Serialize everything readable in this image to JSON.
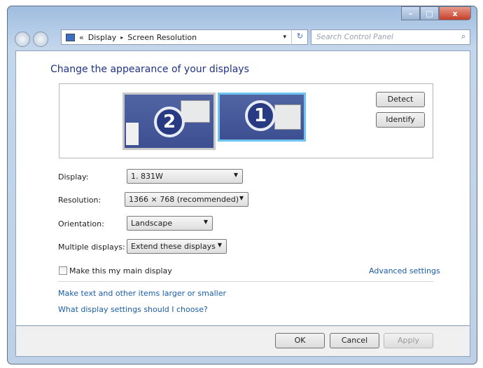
{
  "window": {
    "min": "–",
    "max": "□",
    "close": "x"
  },
  "address": {
    "crumbs": [
      "«",
      "Display",
      "Screen Resolution"
    ],
    "sep": "▸",
    "dropdown": "▾",
    "refresh": "↻"
  },
  "search": {
    "placeholder": "Search Control Panel",
    "icon": "⌕"
  },
  "title": "Change the appearance of your displays",
  "monitors": [
    {
      "number": "2"
    },
    {
      "number": "1"
    }
  ],
  "detect": "Detect",
  "identify": "Identify",
  "fields": [
    {
      "label": "Display:",
      "value": "1. 831W"
    },
    {
      "label": "Resolution:",
      "value": "1366 × 768 (recommended)"
    },
    {
      "label": "Orientation:",
      "value": "Landscape"
    },
    {
      "label": "Multiple displays:",
      "value": "Extend these displays"
    }
  ],
  "main_display": {
    "label": "Make this my main display",
    "checked": false
  },
  "advanced": "Advanced settings",
  "links": [
    "Make text and other items larger or smaller",
    "What display settings should I choose?"
  ],
  "buttons": {
    "ok": "OK",
    "cancel": "Cancel",
    "apply": "Apply"
  }
}
